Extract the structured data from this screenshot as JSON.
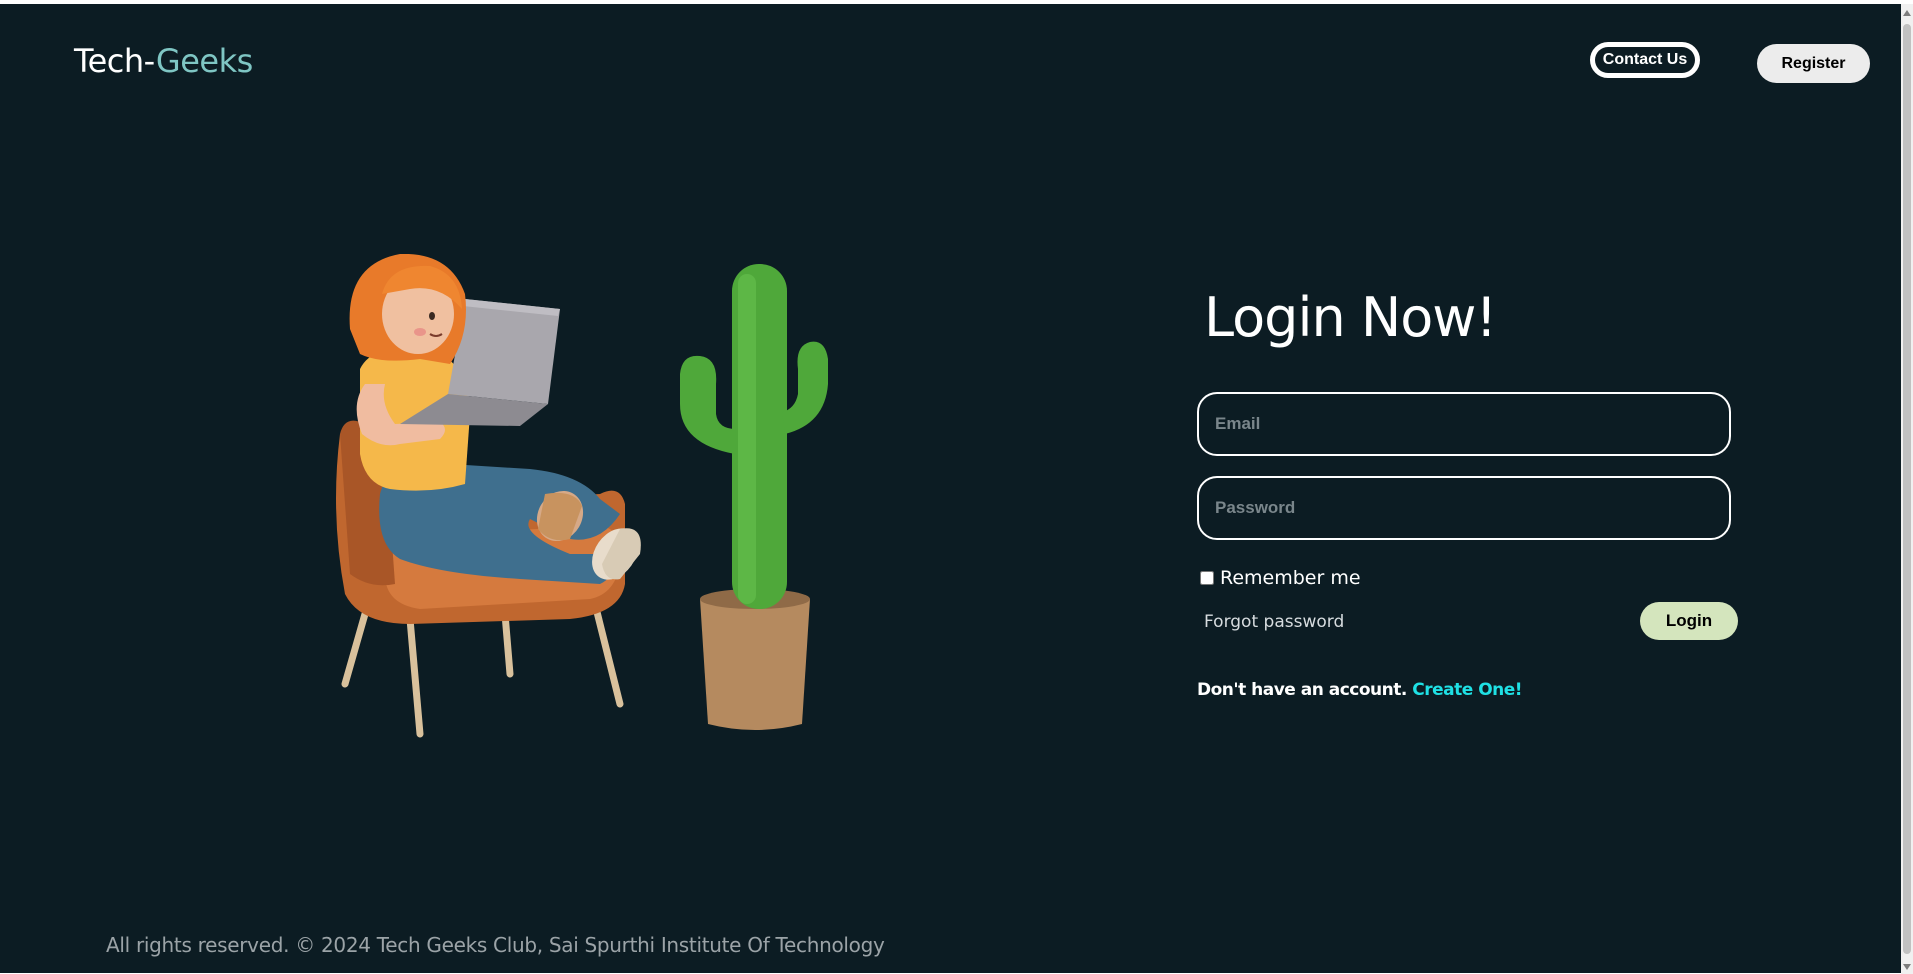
{
  "header": {
    "brand_part1": "Tech-",
    "brand_part2": "Geeks",
    "contact_label": "Contact Us",
    "register_label": "Register"
  },
  "login": {
    "title": "Login Now!",
    "email_placeholder": "Email",
    "password_placeholder": "Password",
    "remember_label": "Remember me",
    "forgot_label": "Forgot password",
    "login_label": "Login",
    "signup_text": "Don't have an account.",
    "signup_link": "Create One!"
  },
  "footer": {
    "text": "All rights reserved. © 2024 Tech Geeks Club, Sai Spurthi Institute Of Technology"
  },
  "colors": {
    "background": "#0c1c23",
    "brand_accent": "#7fc6c4",
    "login_button": "#d4e5bd",
    "link": "#1fe0e4"
  },
  "illustration": {
    "icon": "girl-with-laptop-and-cactus"
  }
}
